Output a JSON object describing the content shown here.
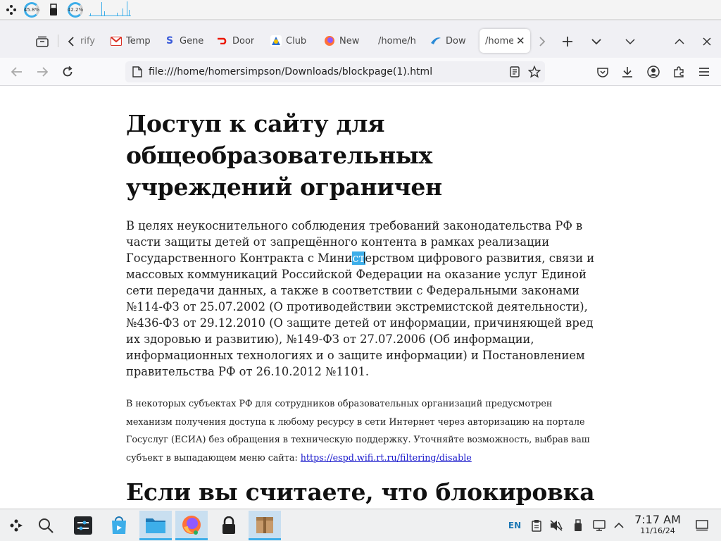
{
  "system_panel": {
    "cpu1_label": "45.8%",
    "cpu2_label": "42.2%"
  },
  "tabs": [
    {
      "label": "rify",
      "favicon": "generic",
      "color": "#888888"
    },
    {
      "label": "Temp",
      "favicon": "gmail-icon",
      "color": "#d93025"
    },
    {
      "label": "Gene",
      "favicon": "s-icon",
      "color": "#3a5bd9"
    },
    {
      "label": "Door",
      "favicon": "doordash-icon",
      "color": "#eb1700"
    },
    {
      "label": "Club",
      "favicon": "club-icon",
      "color": "#2a6fd6"
    },
    {
      "label": "New",
      "favicon": "firefox-icon",
      "color": "#ff7139"
    },
    {
      "label": "/home/h",
      "favicon": "none",
      "color": ""
    },
    {
      "label": "Dow",
      "favicon": "download-icon",
      "color": "#2a8ad6"
    },
    {
      "label": "/home",
      "favicon": "none",
      "color": "",
      "active": true
    }
  ],
  "navbar": {
    "url": "file:///home/homersimpson/Downloads/blockpage(1).html"
  },
  "page": {
    "h1": "Доступ к сайту для общеобразовательных учреждений ограничен",
    "p1_before": "В целях неукоснительного соблюдения требований законодательства РФ в части защиты детей от запрещённого контента в рамках реализации Государственного Контракта с Мини",
    "p1_selected": "ст",
    "p1_after": "ерством цифрового развития, связи и массовых коммуникаций Российской Федерации на оказание услуг Единой сети передачи данных, а также в соответствии с Федеральными законами №114-ФЗ от 25.07.2002 (О противодействии экстремистской деятельности), №436-ФЗ от 29.12.2010 (О защите детей от информации, причиняющей вред их здоровью и развитию), №149-ФЗ от 27.07.2006 (Об информации, информационных технологиях и о защите информации) и Постановлением правительства РФ от 26.10.2012 №1101.",
    "p2_text": "В некоторых субъектах РФ для сотрудников образовательных организаций предусмотрен механизм получения доступа к любому ресурсу в сети Интернет через авторизацию на портале Госуслуг (ЕСИА) без обращения в техническую поддержку. Уточняйте возможность, выбрав ваш субъект в выпадающем меню сайта: ",
    "p2_link": "https://espd.wifi.rt.ru/filtering/disable",
    "h2": "Если вы считаете, что блокировка"
  },
  "taskbar": {
    "keyboard_layout": "EN",
    "time": "7:17 AM",
    "date": "11/16/24"
  },
  "colors": {
    "selection": "#3daee9",
    "link": "#1a1acc",
    "taskbar_active": "#c9dff0"
  }
}
